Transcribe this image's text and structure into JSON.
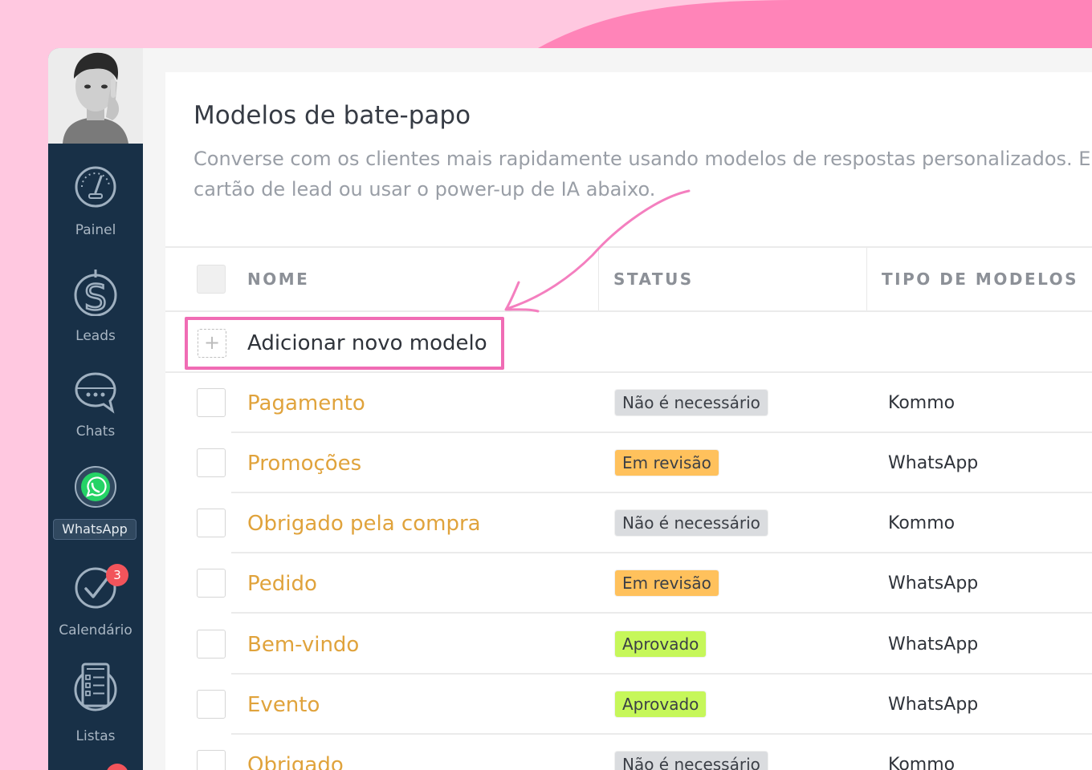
{
  "sidebar": {
    "items": [
      {
        "label": "Painel",
        "icon": "dashboard-gauge-icon"
      },
      {
        "label": "Leads",
        "icon": "dollar-icon"
      },
      {
        "label": "Chats",
        "icon": "chat-bubble-icon"
      },
      {
        "label": "WhatsApp",
        "icon": "whatsapp-icon",
        "active": true
      },
      {
        "label": "Calendário",
        "icon": "checkmark-circle-icon",
        "badge": "3"
      },
      {
        "label": "Listas",
        "icon": "list-icon"
      }
    ]
  },
  "page": {
    "title": "Modelos de bate-papo",
    "description": "Converse com os clientes mais rapidamente usando modelos de respostas personalizados. E cartão de lead ou usar o power-up de IA abaixo."
  },
  "table": {
    "columns": [
      "NOME",
      "STATUS",
      "TIPO DE MODELOS"
    ],
    "add_label": "Adicionar novo modelo",
    "rows": [
      {
        "name": "Pagamento",
        "status": "Não é necessário",
        "type": "Kommo"
      },
      {
        "name": "Promoções",
        "status": "Em revisão",
        "type": "WhatsApp"
      },
      {
        "name": "Obrigado pela compra",
        "status": "Não é necessário",
        "type": "Kommo"
      },
      {
        "name": "Pedido",
        "status": "Em revisão",
        "type": "WhatsApp"
      },
      {
        "name": "Bem-vindo",
        "status": "Aprovado",
        "type": "WhatsApp"
      },
      {
        "name": "Evento",
        "status": "Aprovado",
        "type": "WhatsApp"
      },
      {
        "name": "Obrigado",
        "status": "Não é necessário",
        "type": "Kommo"
      }
    ]
  },
  "colors": {
    "sidebar": "#183047",
    "accent_pink": "#f06cb4",
    "link_orange": "#e0a33c",
    "status_not_needed": "#dadcdf",
    "status_review": "#ffc15c",
    "status_approved": "#c6f75a",
    "whatsapp_green": "#25d366"
  }
}
